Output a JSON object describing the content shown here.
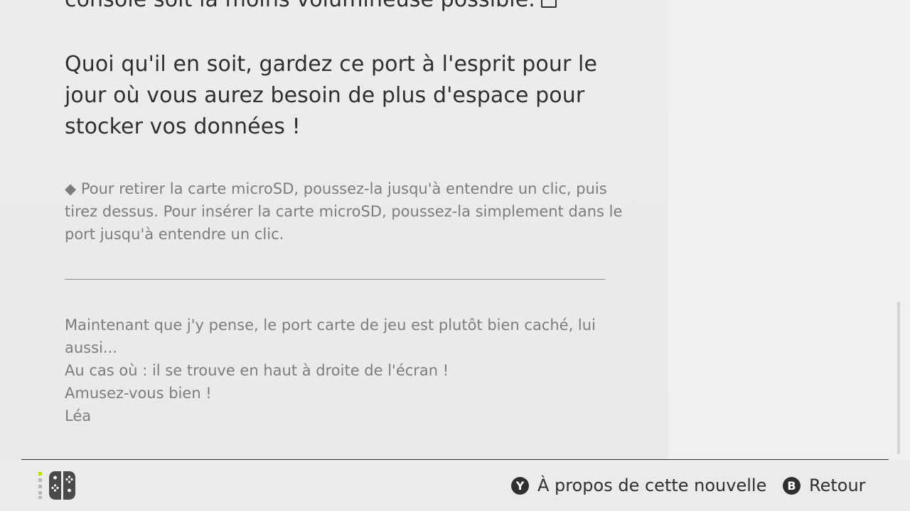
{
  "article": {
    "top_line": "console soit la moins volumineuse possible.",
    "main_paragraph": "Quoi qu'il en soit, gardez ce port à l'esprit pour le jour où vous aurez besoin de plus d'espace pour stocker vos données !",
    "note": "◆ Pour retirer la carte microSD, poussez-la jusqu'à entendre un clic, puis tirez dessus. Pour insérer la carte microSD, poussez-la simplement dans le port jusqu'à entendre un clic.",
    "after_divider_line1": "Maintenant que j'y pense, le port carte de jeu est plutôt bien caché, lui aussi...",
    "after_divider_line2": "Au cas où : il se trouve en haut à droite de l'écran !",
    "signoff_line1": "Amusez-vous bien !",
    "signoff_line2": "Léa"
  },
  "footer": {
    "controller_icon": "joycon-controller-icon",
    "about_button": {
      "glyph": "Y",
      "label": "À propos de cette nouvelle"
    },
    "back_button": {
      "glyph": "B",
      "label": "Retour"
    }
  },
  "colors": {
    "background": "#ebebeb",
    "text_primary": "#2f2f2f",
    "text_secondary": "#7c7c7c",
    "accent_indicator": "#b7e000"
  }
}
